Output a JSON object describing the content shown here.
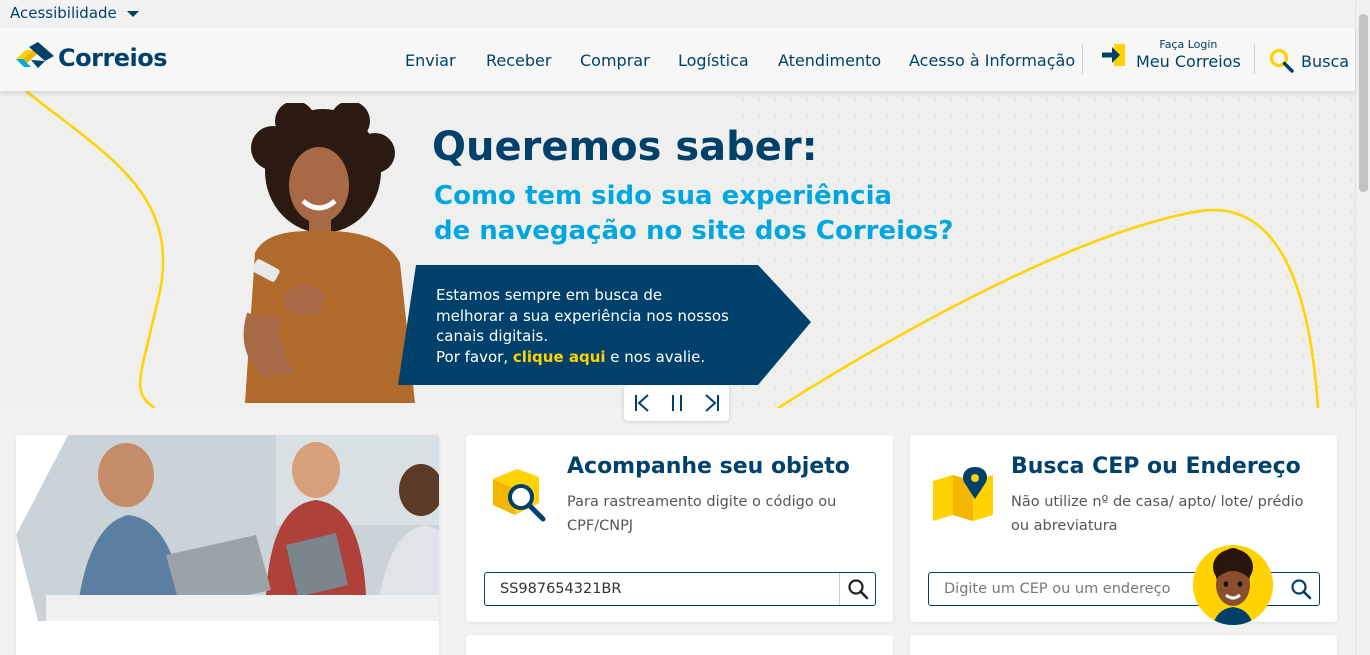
{
  "accessibility": {
    "label": "Acessibilidade"
  },
  "header": {
    "logo_text": "Correios",
    "nav": [
      "Enviar",
      "Receber",
      "Comprar",
      "Logística",
      "Atendimento",
      "Acesso à Informação"
    ],
    "login_small": "Faça Login",
    "login_big": "Meu Correios",
    "search_label": "Busca"
  },
  "banner": {
    "title": "Queremos saber:",
    "subtitle_line1": "Como tem sido sua experiência",
    "subtitle_line2": "de navegação no site dos Correios?",
    "box_line1": "Estamos sempre em busca de",
    "box_line2": "melhorar a sua experiência nos nossos",
    "box_line3": "canais digitais.",
    "box_line4_prefix": "Por favor, ",
    "box_link": "clique aqui",
    "box_line4_suffix": " e nos avalie."
  },
  "tracking": {
    "title": "Acompanhe seu objeto",
    "description": "Para rastreamento digite o código ou CPF/CNPJ",
    "input_value": "SS987654321BR"
  },
  "cep": {
    "title": "Busca CEP ou Endereço",
    "description": "Não utilize nº de casa/ apto/ lote/ prédio ou abreviatura",
    "placeholder": "Digite um CEP ou um endereço"
  },
  "colors": {
    "navy": "#00416b",
    "cyan": "#00a6e0",
    "yellow": "#ffd200"
  }
}
